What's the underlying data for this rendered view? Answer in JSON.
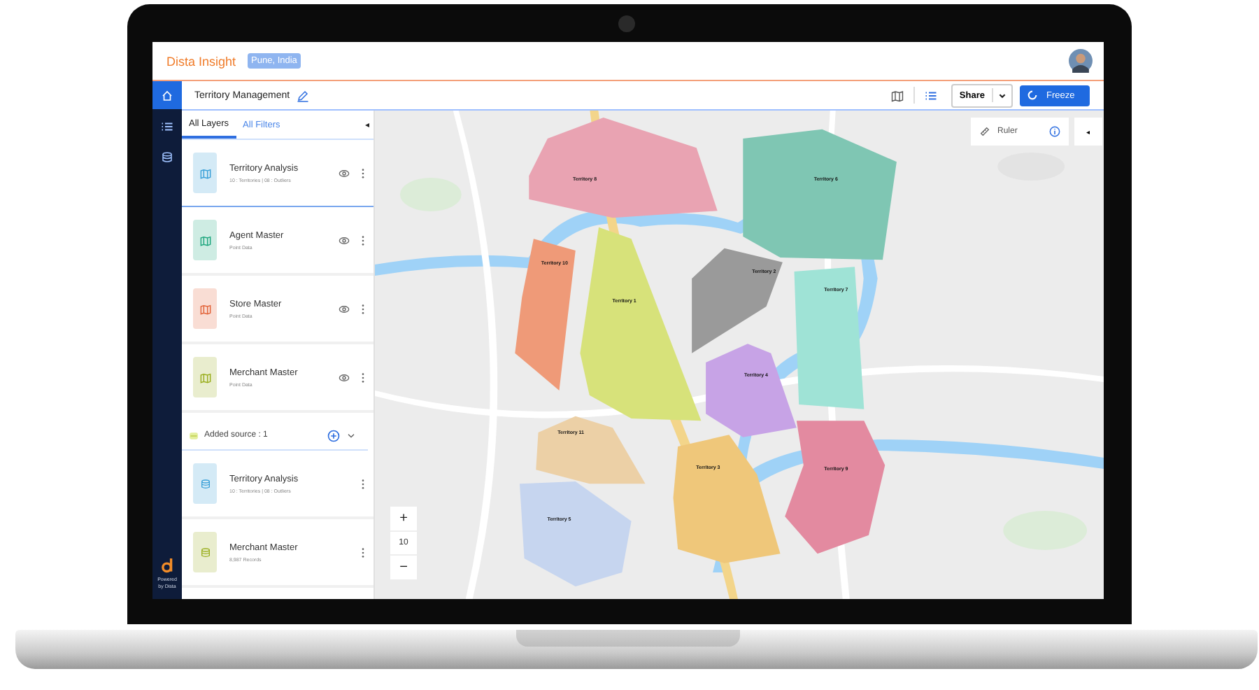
{
  "header": {
    "brand": "Dista Insight",
    "location": "Pune, India"
  },
  "toolbar": {
    "title": "Territory Management",
    "share": "Share",
    "freeze": "Freeze"
  },
  "rail": [
    {
      "kind": "home",
      "selected": true
    },
    {
      "kind": "list",
      "selected": false
    },
    {
      "kind": "database",
      "selected": false
    }
  ],
  "powered_by": "Powered by Dista",
  "panel": {
    "tabs": [
      {
        "label": "All Layers",
        "selected": true
      },
      {
        "label": "All Filters",
        "selected": false
      }
    ],
    "collapse": "◂",
    "layers": [
      {
        "name": "Territory Analysis",
        "detail": "10 : Territories | 08 : Outliers",
        "color": "#3aa0d8",
        "selected": true
      },
      {
        "name": "Agent Master",
        "detail": "Point Data",
        "color": "#20a77f",
        "selected": false
      },
      {
        "name": "Store Master",
        "detail": "Point Data",
        "color": "#e2643a",
        "selected": false
      },
      {
        "name": "Merchant Master",
        "detail": "Point Data",
        "color": "#9aae1e",
        "selected": false
      }
    ],
    "added_source": "Added source : 1",
    "sources": [
      {
        "name": "Territory Analysis",
        "detail": "10 : Territories | 08 : Outliers",
        "color": "#3aa0d8"
      },
      {
        "name": "Merchant Master",
        "detail": "8,987 Records",
        "color": "#9aae1e"
      }
    ]
  },
  "map": {
    "ruler": "Ruler",
    "collapse": "◂",
    "zoom_in": "+",
    "zoom_level": "10",
    "zoom_out": "−",
    "territories": [
      {
        "label": "Territory 8",
        "color": "#e9a3b2"
      },
      {
        "label": "Territory 6",
        "color": "#7fc6b3"
      },
      {
        "label": "Territory 10",
        "color": "#ef9a78"
      },
      {
        "label": "Territory 1",
        "color": "#d7e27a"
      },
      {
        "label": "Territory 2",
        "color": "#9a9a9a"
      },
      {
        "label": "Territory 7",
        "color": "#9fe3d6"
      },
      {
        "label": "Territory 4",
        "color": "#c7a3e6"
      },
      {
        "label": "Territory 11",
        "color": "#ecd0a6"
      },
      {
        "label": "Territory 3",
        "color": "#efc77a"
      },
      {
        "label": "Territory 9",
        "color": "#e38aa0"
      },
      {
        "label": "Territory 5",
        "color": "#c6d5ef"
      }
    ]
  }
}
